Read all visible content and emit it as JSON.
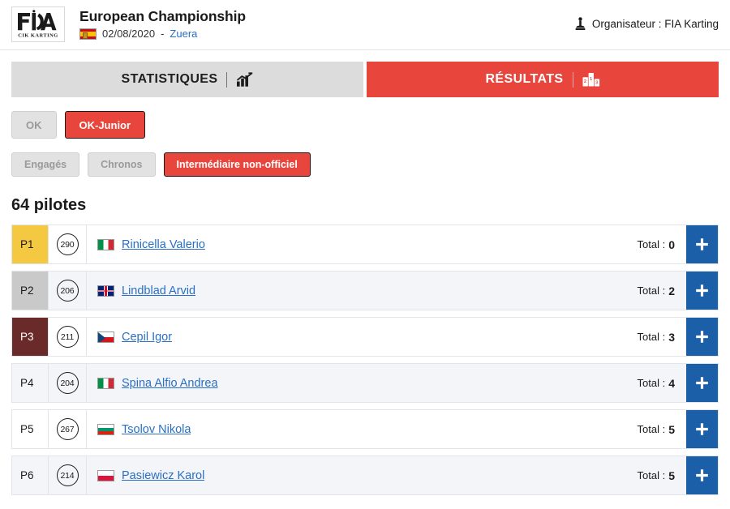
{
  "header": {
    "logo_alt": "FIA CIK KARTING",
    "logo_line1": "FIA",
    "logo_line2": "CIK KARTING",
    "event_title": "European Championship",
    "country_flag": "flag-es",
    "date": "02/08/2020",
    "separator": "-",
    "venue": "Zuera",
    "organiser_icon": "organiser-icon",
    "organiser_label": "Organisateur : FIA Karting"
  },
  "tabs": [
    {
      "label": "STATISTIQUES",
      "icon": "bar-chart-icon",
      "active": false
    },
    {
      "label": "RÉSULTATS",
      "icon": "podium-icon",
      "active": true
    }
  ],
  "category_filters": [
    {
      "label": "OK",
      "active": false
    },
    {
      "label": "OK-Junior",
      "active": true
    }
  ],
  "session_filters": [
    {
      "label": "Engagés",
      "active": false
    },
    {
      "label": "Chronos",
      "active": false
    },
    {
      "label": "Intermédiaire non-officiel",
      "active": true
    }
  ],
  "results": {
    "count_label": "64 pilotes",
    "total_prefix": "Total :",
    "add_button_icon": "plus-icon",
    "rows": [
      {
        "position": "P1",
        "medal": "gold",
        "number": "290",
        "flag": "flag-it",
        "flag_name": "italy-flag",
        "driver": "Rinicella Valerio",
        "total": "0"
      },
      {
        "position": "P2",
        "medal": "silver",
        "number": "206",
        "flag": "flag-gb",
        "flag_name": "united-kingdom-flag",
        "driver": "Lindblad Arvid",
        "total": "2"
      },
      {
        "position": "P3",
        "medal": "bronze",
        "number": "211",
        "flag": "flag-cz",
        "flag_name": "czech-republic-flag",
        "driver": "Cepil Igor",
        "total": "3"
      },
      {
        "position": "P4",
        "medal": "plain",
        "number": "204",
        "flag": "flag-it",
        "flag_name": "italy-flag",
        "driver": "Spina Alfio Andrea",
        "total": "4"
      },
      {
        "position": "P5",
        "medal": "plain",
        "number": "267",
        "flag": "flag-bg",
        "flag_name": "bulgaria-flag",
        "driver": "Tsolov Nikola",
        "total": "5"
      },
      {
        "position": "P6",
        "medal": "plain",
        "number": "214",
        "flag": "flag-pl",
        "flag_name": "poland-flag",
        "driver": "Pasiewicz Karol",
        "total": "5"
      }
    ]
  },
  "colors": {
    "accent_red": "#e8463c",
    "link_blue": "#2a6fc4",
    "add_blue": "#1a5fa8",
    "gold": "#f5c842",
    "silver": "#c9c9c9",
    "bronze": "#6b2a2a",
    "tab_inactive": "#dcdcdc",
    "row_alt": "#f3f5f9"
  }
}
